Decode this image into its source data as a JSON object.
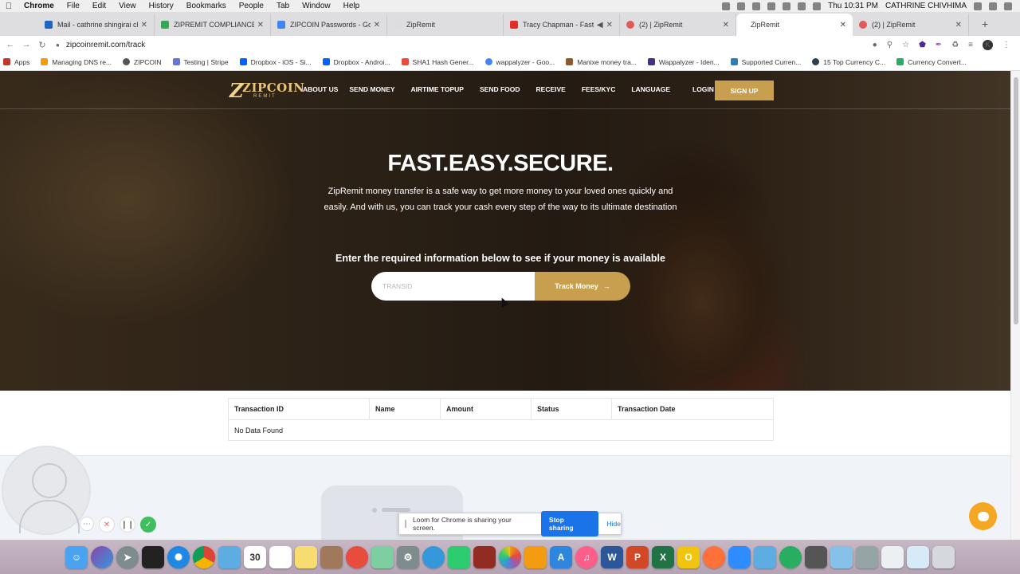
{
  "menubar": {
    "items": [
      "Chrome",
      "File",
      "Edit",
      "View",
      "History",
      "Bookmarks",
      "People",
      "Tab",
      "Window",
      "Help"
    ],
    "clock": "Thu 10:31 PM",
    "user": "CATHRINE CHIVHIMA"
  },
  "tabs": [
    {
      "title": "Mail - cathrine shingirai chi",
      "color": "#1f66c4"
    },
    {
      "title": "ZIPREMIT COMPLIANCE DO",
      "color": "#34a853"
    },
    {
      "title": "ZIPCOIN Passwords - Goog",
      "color": "#4285f4"
    },
    {
      "title": "ZipRemit",
      "color": "#dddddd"
    },
    {
      "title": "Tracy Chapman - Fast",
      "color": "#e52d27"
    },
    {
      "title": "(2) | ZipRemit",
      "color": "#e05a5a"
    },
    {
      "title": "ZipRemit",
      "color": "#ffffff"
    },
    {
      "title": "(2) | ZipRemit",
      "color": "#e05a5a"
    }
  ],
  "address": {
    "url": "zipcoinremit.com/track",
    "avatar_letter": "K"
  },
  "bookmarks": [
    {
      "label": "Apps",
      "color": "#c0392b"
    },
    {
      "label": "Managing DNS re...",
      "color": "#f39c12"
    },
    {
      "label": "ZIPCOIN",
      "color": "#555555"
    },
    {
      "label": "Testing | Stripe",
      "color": "#6772e5"
    },
    {
      "label": "Dropbox - iOS - Si...",
      "color": "#0061ff"
    },
    {
      "label": "Dropbox - Androi...",
      "color": "#0061ff"
    },
    {
      "label": "SHA1 Hash Gener...",
      "color": "#e74c3c"
    },
    {
      "label": "wappalyzer - Goo...",
      "color": "#4285f4"
    },
    {
      "label": "Manixe money tra...",
      "color": "#8e5a2b"
    },
    {
      "label": "Wappalyzer - Iden...",
      "color": "#4b2c8c"
    },
    {
      "label": "Supported Curren...",
      "color": "#2980b9"
    },
    {
      "label": "15 Top Currency C...",
      "color": "#2c3e50"
    },
    {
      "label": "Currency Convert...",
      "color": "#27ae60"
    }
  ],
  "site": {
    "logo_main": "ZIPCOIN",
    "logo_sub": "REMIT",
    "nav": [
      "ABOUT US",
      "SEND MONEY",
      "AIRTIME TOPUP",
      "SEND FOOD",
      "RECEIVE",
      "FEES/KYC",
      "LANGUAGE",
      "LOGIN"
    ],
    "signup": "SIGN UP",
    "hero_title": "FAST.EASY.SECURE.",
    "hero_sub": "ZipRemit money transfer is a safe way to get more money to your loved ones quickly and easily. And with us, you can track your cash every step of the way to its ultimate destination",
    "prompt": "Enter the required information below to see if your money is available",
    "track_placeholder": "TRANSID",
    "track_value": "",
    "track_button": "Track Money",
    "accent": "#c89f4e"
  },
  "table": {
    "headers": [
      "Transaction ID",
      "Name",
      "Amount",
      "Status",
      "Transaction Date"
    ],
    "empty": "No Data Found"
  },
  "loom": {
    "message": "Loom for Chrome is sharing your screen.",
    "stop": "Stop sharing",
    "hide": "Hide"
  },
  "dock_icons": [
    "finder-icon",
    "siri-icon",
    "launchpad-icon",
    "terminal-icon",
    "safari-icon",
    "chrome-icon",
    "preview-icon",
    "calendar-icon",
    "reminders-icon",
    "notes-icon",
    "books-icon",
    "screen-icon",
    "maps-icon",
    "system-preferences-icon",
    "messages-icon",
    "facetime-icon",
    "photo-booth-icon",
    "photos-icon",
    "ibooks-icon",
    "app-store-icon",
    "itunes-icon",
    "word-icon",
    "powerpoint-icon",
    "excel-icon",
    "outlook-icon",
    "firefox-icon",
    "zoom-icon",
    "teams-icon",
    "network-icon",
    "calculator-icon",
    "xcode-icon",
    "automator-icon",
    "documents-icon",
    "files-icon",
    "trash-icon"
  ],
  "dock": {
    "calendar_day": "30"
  }
}
